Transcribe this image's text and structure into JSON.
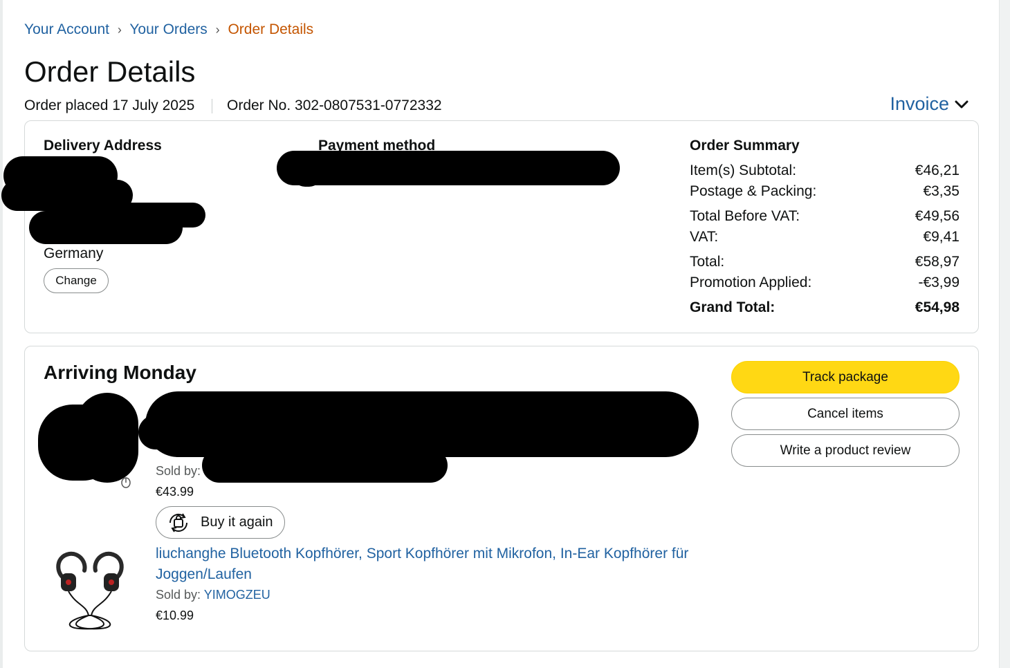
{
  "breadcrumb": {
    "account": "Your Account",
    "orders": "Your Orders",
    "current": "Order Details",
    "separator": "›"
  },
  "page_title": "Order Details",
  "order": {
    "placed": "Order placed 17 July 2025",
    "number": "Order No. 302-0807531-0772332"
  },
  "invoice_label": "Invoice",
  "delivery": {
    "heading": "Delivery Address",
    "country": "Germany",
    "change_label": "Change"
  },
  "payment": {
    "heading": "Payment method"
  },
  "summary": {
    "heading": "Order Summary",
    "rows": [
      {
        "label": "Item(s) Subtotal:",
        "value": "€46,21"
      },
      {
        "label": "Postage & Packing:",
        "value": "€3,35"
      },
      {
        "label": "Total Before VAT:",
        "value": "€49,56"
      },
      {
        "label": "VAT:",
        "value": "€9,41"
      },
      {
        "label": "Total:",
        "value": "€58,97"
      },
      {
        "label": "Promotion Applied:",
        "value": "-€3,99"
      }
    ],
    "grand_total": {
      "label": "Grand Total:",
      "value": "€54,98"
    }
  },
  "shipment": {
    "status": "Arriving Monday",
    "actions": {
      "track": "Track package",
      "cancel": "Cancel items",
      "review": "Write a product review"
    },
    "items": [
      {
        "sold_by_label": "Sold by:",
        "price": "€43.99",
        "buy_again": "Buy it again"
      },
      {
        "title": "liuchanghe Bluetooth Kopfhörer, Sport Kopfhörer mit Mikrofon, In-Ear Kopfhörer für Joggen/Laufen",
        "sold_by_label": "Sold by:",
        "seller": "YIMOGZEU",
        "price": "€10.99"
      }
    ]
  },
  "colors": {
    "link": "#2162a1",
    "breadcrumb_current": "#c45500",
    "primary_button": "#ffd814",
    "text": "#0f1111"
  }
}
